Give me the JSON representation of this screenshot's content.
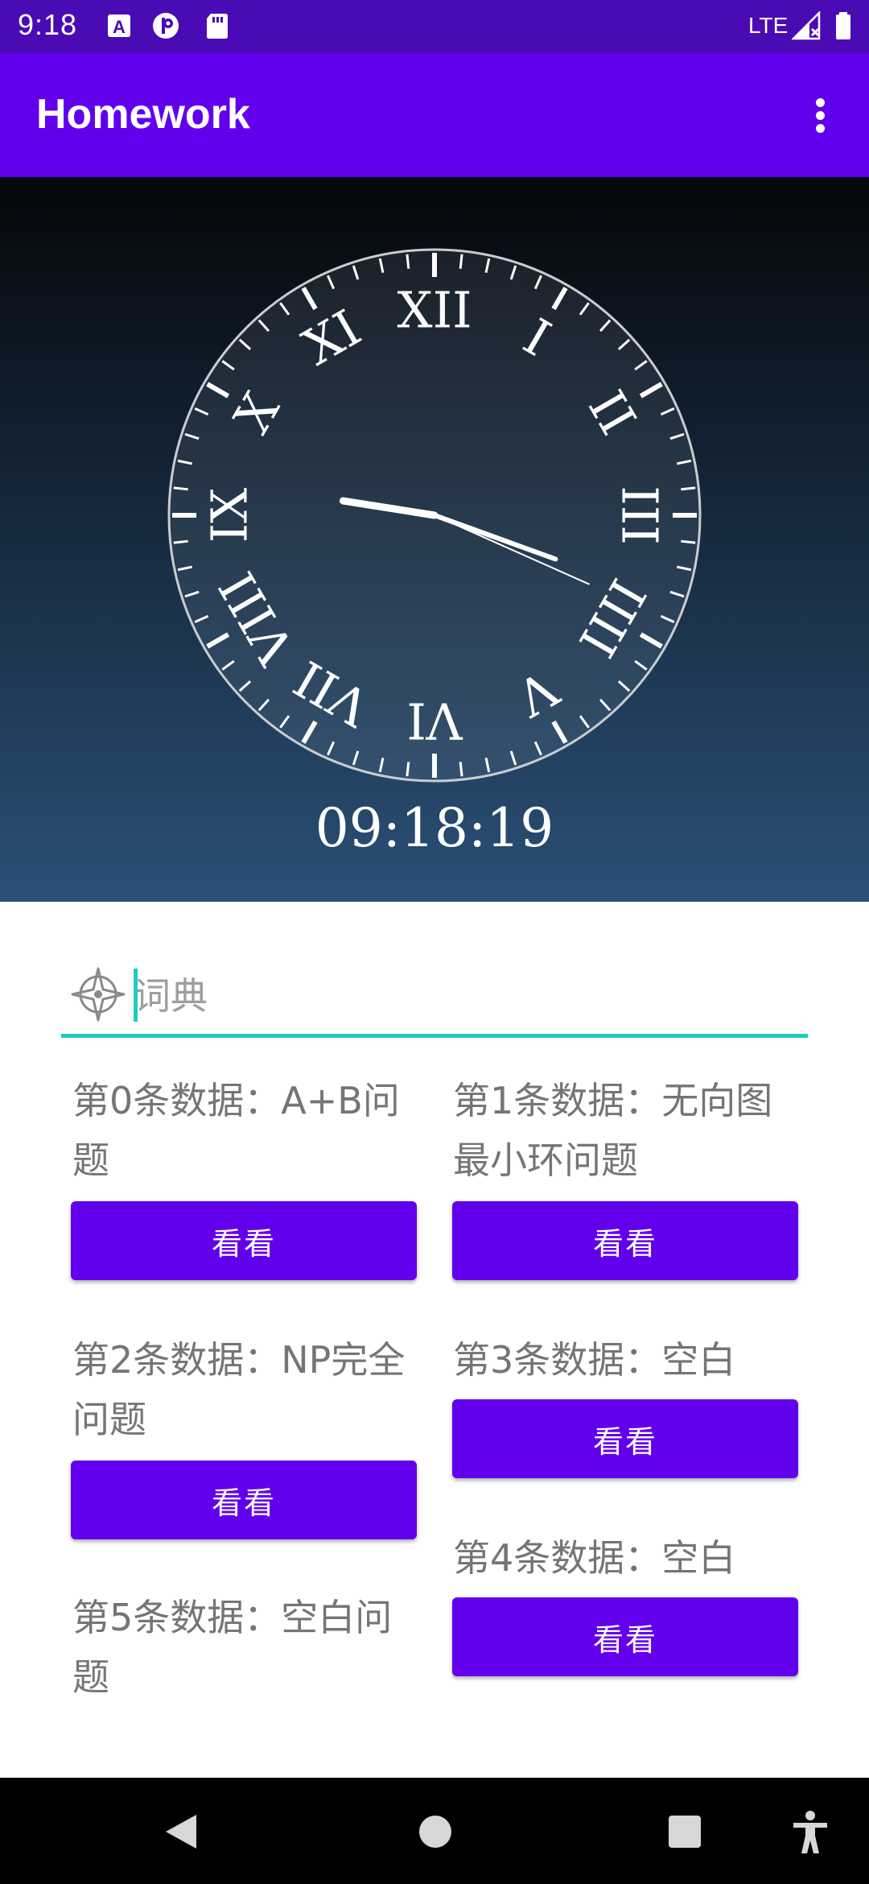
{
  "status_bar": {
    "time": "9:18",
    "network": "LTE",
    "icons": [
      "keyboard-a-icon",
      "circle-p-icon",
      "sd-card-icon",
      "signal-icon",
      "battery-icon"
    ]
  },
  "app_bar": {
    "title": "Homework",
    "menu_icon": "more-vert-icon"
  },
  "clock": {
    "numerals": [
      "XII",
      "I",
      "II",
      "III",
      "IIII",
      "V",
      "VI",
      "VII",
      "VIII",
      "IX",
      "X",
      "XI"
    ],
    "time": {
      "hours": 9,
      "minutes": 18,
      "seconds": 19
    },
    "digital": "09:18:19"
  },
  "search": {
    "placeholder": "词典",
    "value": "",
    "icon": "compass-icon"
  },
  "items": [
    {
      "label": "第0条数据：A+B问题",
      "button": "看看"
    },
    {
      "label": "第1条数据：无向图最小环问题",
      "button": "看看"
    },
    {
      "label": "第2条数据：NP完全问题",
      "button": "看看"
    },
    {
      "label": "第3条数据：空白",
      "button": "看看"
    },
    {
      "label": "第4条数据：空白",
      "button": "看看"
    },
    {
      "label": "第5条数据：空白问题"
    }
  ],
  "colors": {
    "primary": "#6200ee",
    "primary_dark": "#4a0bb5",
    "accent": "#1ecbc0"
  },
  "nav_bar": {
    "icons": [
      "back-icon",
      "home-icon",
      "recents-icon",
      "accessibility-icon"
    ]
  }
}
